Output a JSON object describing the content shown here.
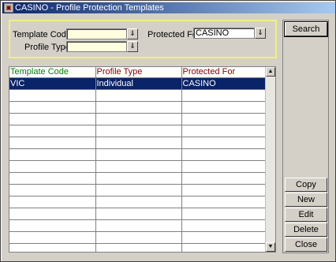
{
  "window": {
    "title": "CASINO - Profile Protection Templates",
    "app_icon": "window-icon"
  },
  "search": {
    "template_code_label": "Template Code",
    "template_code_value": "",
    "profile_type_label": "Profile Type",
    "profile_type_value": "",
    "protected_for_label": "Protected For",
    "protected_for_value": "CASINO"
  },
  "grid": {
    "columns": [
      "Template Code",
      "Profile Type",
      "Protected For"
    ],
    "rows": [
      [
        "VIC",
        "Individual",
        "CASINO"
      ]
    ],
    "empty_rows": 14
  },
  "buttons": {
    "search": "Search",
    "copy": "Copy",
    "new": "New",
    "edit": "Edit",
    "delete": "Delete",
    "close": "Close"
  }
}
